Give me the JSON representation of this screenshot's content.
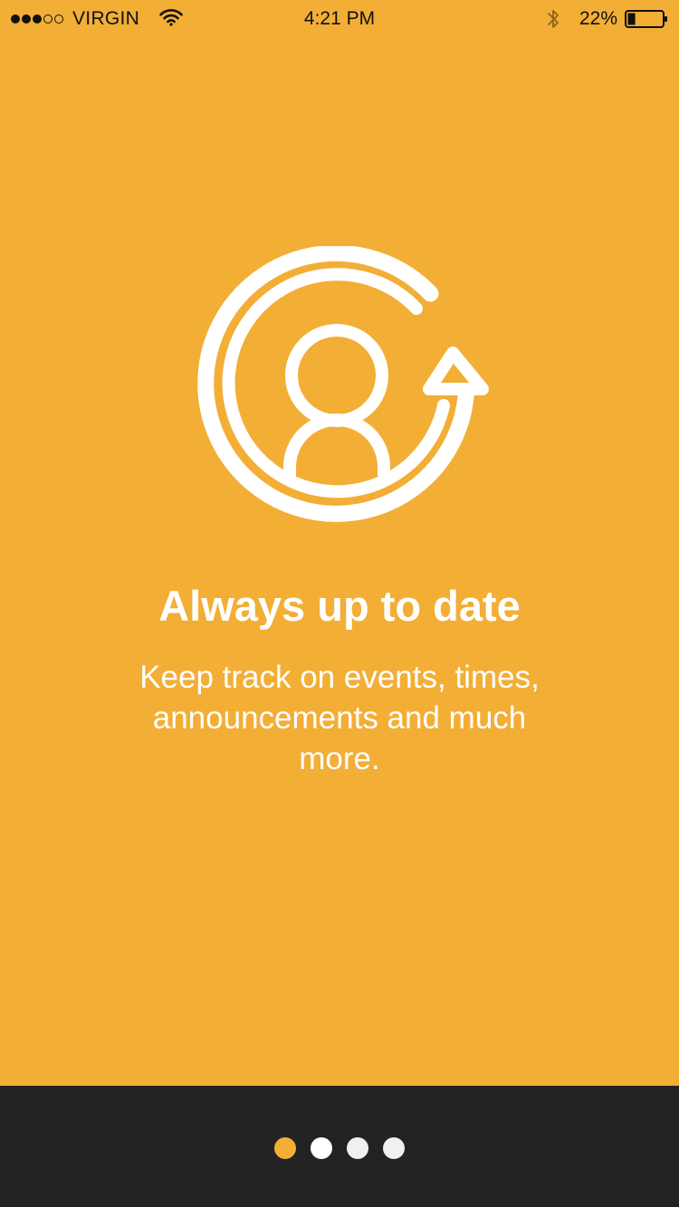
{
  "status_bar": {
    "signal_filled": 3,
    "signal_total": 5,
    "carrier": "VIRGIN",
    "time": "4:21 PM",
    "battery_percent": "22%",
    "battery_level": 0.22,
    "icons": [
      "wifi-icon",
      "bluetooth-icon",
      "battery-icon"
    ]
  },
  "onboarding": {
    "icon": "user-refresh-icon",
    "title": "Always up to date",
    "description": "Keep track on events, times, announcements and much more."
  },
  "pager": {
    "total": 4,
    "active_index": 0
  },
  "colors": {
    "accent": "#F3AE36",
    "footer": "#232323",
    "text": "#FFFFFF"
  }
}
